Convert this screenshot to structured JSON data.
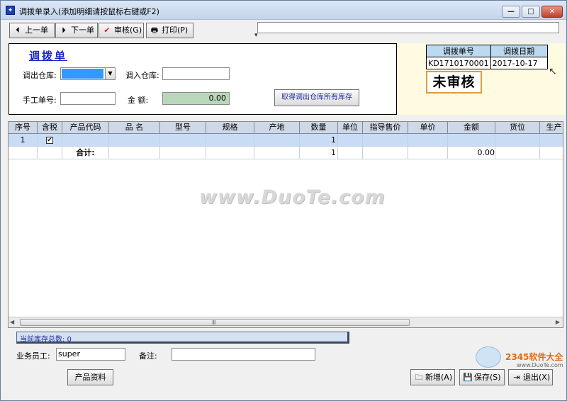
{
  "window": {
    "title": "调拨单录入(添加明细请按鼠标右键或F2)",
    "min_glyph": "—",
    "max_glyph": "□",
    "close_glyph": "✕"
  },
  "toolbar": {
    "prev_label": "上一单",
    "next_label": "下一单",
    "audit_label": "审核(G)",
    "print_label": "打印(P)",
    "prev_glyph": "⏴",
    "next_glyph": "⏵",
    "audit_glyph": "✔",
    "print_glyph": "🖶"
  },
  "form": {
    "title": "调拨单",
    "out_warehouse_label": "调出仓库:",
    "in_warehouse_label": "调入仓库:",
    "manual_no_label": "手工单号:",
    "amount_label": "金  额:",
    "amount_value": "0.00",
    "get_stock_button": "取得调出仓库所有库存",
    "dropdown_glyph": "▼"
  },
  "info": {
    "no_header": "调拨单号",
    "date_header": "调拨日期",
    "no_value": "KD1710170001",
    "date_value": "2017-10-17",
    "status": "未审核",
    "accent_color": "#e49a3c"
  },
  "grid": {
    "headers": [
      "序号",
      "含税",
      "产品代码",
      "品  名",
      "型号",
      "规格",
      "产地",
      "数量",
      "单位",
      "指导售价",
      "单价",
      "金额",
      "货位",
      "生产"
    ],
    "row1": {
      "seq": "1",
      "tax_checked": "✔",
      "qty": "1"
    },
    "total": {
      "label": "合计:",
      "qty": "1",
      "amount": "0.00"
    },
    "scroll_grip": "Ⅲ",
    "scroll_left": "◀",
    "scroll_right": "▶"
  },
  "watermark": "www.DuoTe.com",
  "footer": {
    "stock_total": "当前库存总数: 0",
    "staff_label": "业务员工:",
    "staff_value": "super",
    "note_label": "备注:",
    "product_button": "产品资料",
    "new_button": "新增(A)",
    "save_button": "保存(S)",
    "exit_button": "退出(X)",
    "new_glyph": "🗀",
    "save_glyph": "💾",
    "exit_glyph": "⇥"
  },
  "branding": {
    "logo_text": "2345软件大全",
    "logo_sub": "www.DuoTe.com"
  }
}
